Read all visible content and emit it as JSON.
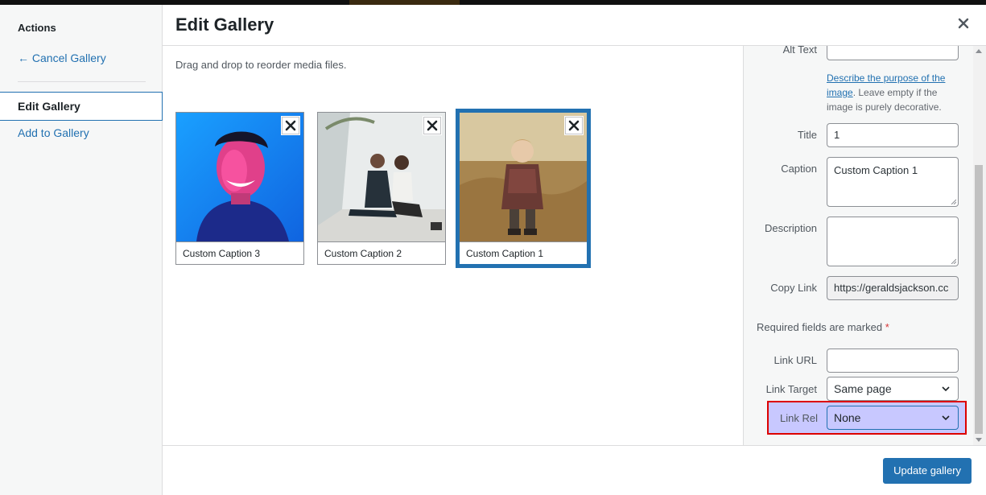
{
  "menu": {
    "heading": "Actions",
    "cancel_label": "← Cancel Gallery",
    "edit_label": "Edit Gallery",
    "add_label": "Add to Gallery"
  },
  "title": "Edit Gallery",
  "content": {
    "instructions": "Drag and drop to reorder media files."
  },
  "gallery": {
    "items": [
      {
        "caption": "Custom Caption 3",
        "selected": false
      },
      {
        "caption": "Custom Caption 2",
        "selected": false
      },
      {
        "caption": "Custom Caption 1",
        "selected": true
      }
    ]
  },
  "details": {
    "alt_label": "Alt Text",
    "alt_value": "",
    "alt_help_link": "Describe the purpose of the image",
    "alt_help_text": ". Leave empty if the image is purely decorative.",
    "title_label": "Title",
    "title_value": "1",
    "caption_label": "Caption",
    "caption_value": "Custom Caption 1",
    "description_label": "Description",
    "description_value": "",
    "copy_link_label": "Copy Link",
    "copy_link_value": "https://geraldsjackson.cc",
    "required_text": "Required fields are marked",
    "required_star": "*",
    "link_url_label": "Link URL",
    "link_url_value": "",
    "link_target_label": "Link Target",
    "link_target_value": "Same page",
    "link_rel_label": "Link Rel",
    "link_rel_value": "None"
  },
  "footer": {
    "update_label": "Update gallery"
  },
  "colors": {
    "accent": "#2271b1",
    "highlight_border": "#dd0000",
    "highlight_fill": "#c8c8ff"
  }
}
